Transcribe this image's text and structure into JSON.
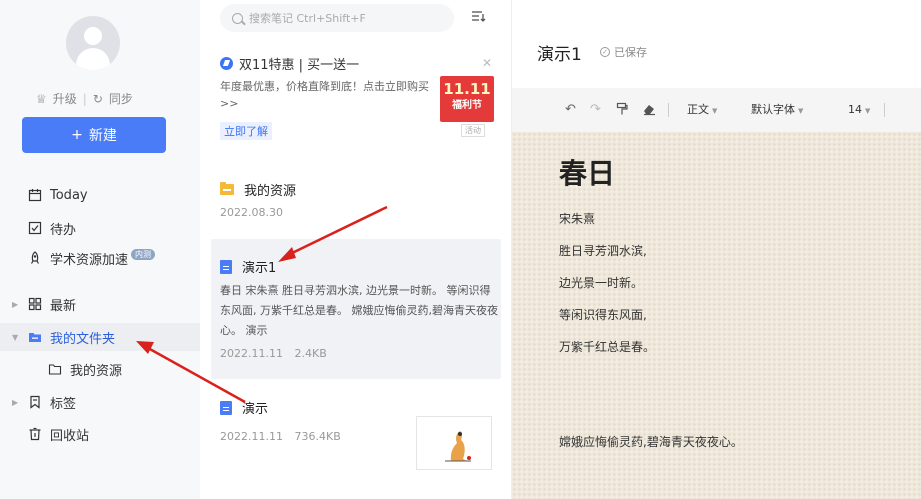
{
  "sidebar": {
    "upgrade_label": "升级",
    "sync_label": "同步",
    "new_button_label": "新建",
    "items": [
      {
        "label": "Today"
      },
      {
        "label": "待办"
      },
      {
        "label": "学术资源加速",
        "badge": "内测"
      },
      {
        "label": "最新"
      },
      {
        "label": "我的文件夹"
      },
      {
        "label": "我的资源"
      },
      {
        "label": "标签"
      },
      {
        "label": "回收站"
      }
    ]
  },
  "notelist": {
    "search_placeholder": "搜索笔记 Ctrl+Shift+F",
    "promo": {
      "title": "双11特惠 | 买一送一",
      "text": "年度最优惠，价格直降到底！点击立即购买>>",
      "image_big": "11.11",
      "image_small": "福利节",
      "link": "立即了解",
      "tag": "活动"
    },
    "notes": [
      {
        "title": "我的资源",
        "date": "2022.08.30",
        "size": ""
      },
      {
        "title": "演示1",
        "snippet": "春日 宋朱熹 胜日寻芳泗水滨, 边光景一时新。 等闲识得东风面, 万紫千红总是春。 嫦娥应悔偷灵药,碧海青天夜夜心。 演示",
        "date": "2022.11.11",
        "size": "2.4KB"
      },
      {
        "title": "演示",
        "date": "2022.11.11",
        "size": "736.4KB"
      }
    ]
  },
  "editor": {
    "title": "演示1",
    "saved_label": "已保存",
    "toolbar": {
      "style_label": "正文",
      "font_label": "默认字体",
      "size_label": "14"
    },
    "content": {
      "heading": "春日",
      "lines": [
        "宋朱熹",
        "胜日寻芳泗水滨,",
        "边光景一时新。",
        "等闲识得东风面,",
        "万紫千红总是春。",
        "嫦娥应悔偷灵药,碧海青天夜夜心。"
      ]
    }
  },
  "colors": {
    "accent": "#4a7cf7",
    "annotation": "#d9221c",
    "folder": "#f5b93a"
  }
}
